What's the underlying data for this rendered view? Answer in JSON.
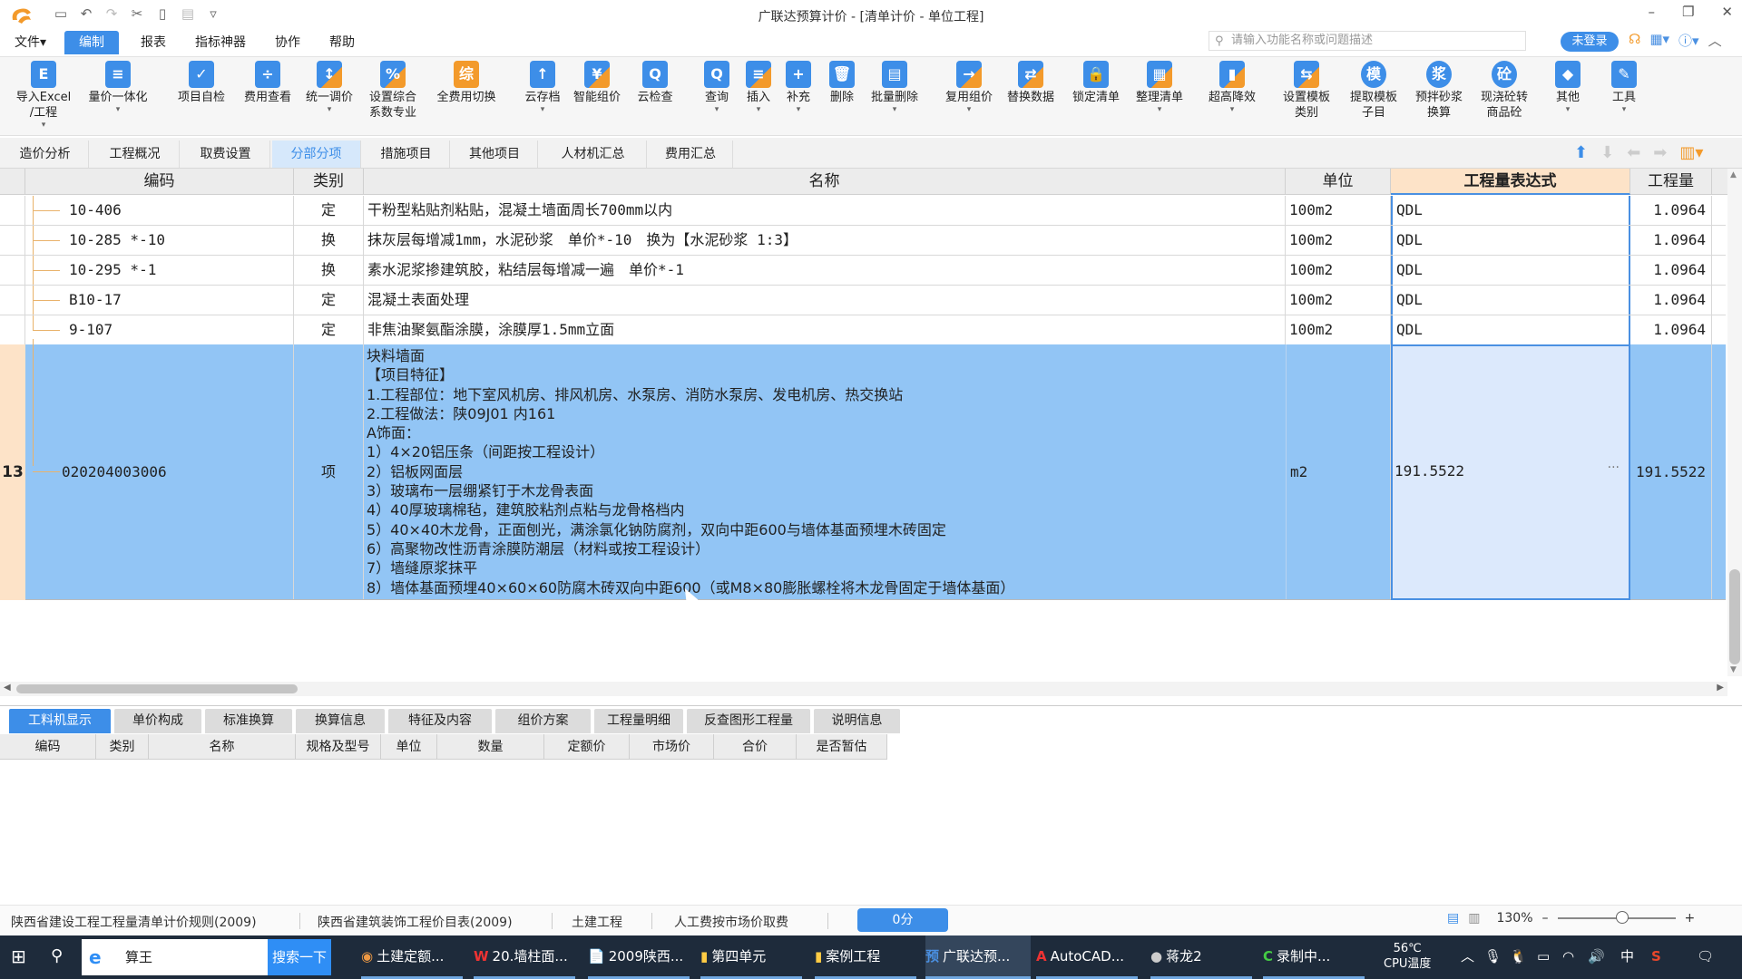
{
  "window": {
    "title": "广联达预算计价 - [清单计价 - 单位工程]",
    "controls": [
      "minimize",
      "restore",
      "close"
    ]
  },
  "quick_access": [
    "save-icon",
    "undo-icon",
    "redo-icon",
    "cut-icon",
    "copy-icon",
    "paste-icon",
    "customize-icon"
  ],
  "menu": {
    "items": [
      {
        "label": "文件▾",
        "active": false
      },
      {
        "label": "编制",
        "active": true
      },
      {
        "label": "报表",
        "active": false
      },
      {
        "label": "指标神器",
        "active": false
      },
      {
        "label": "协作",
        "active": false
      },
      {
        "label": "帮助",
        "active": false
      }
    ],
    "search_placeholder": "请输入功能名称或问题描述",
    "login_label": "未登录"
  },
  "ribbon": [
    {
      "label": "导入Excel",
      "label2": "/工程",
      "glyph": "E",
      "dd": true
    },
    {
      "label": "量价一体化",
      "label2": "",
      "glyph": "≡",
      "dd": true
    },
    {
      "label": "项目自检",
      "label2": "",
      "glyph": "✓",
      "dd": false
    },
    {
      "label": "费用查看",
      "label2": "",
      "glyph": "÷",
      "dd": false
    },
    {
      "label": "统一调价",
      "label2": "",
      "glyph": "↕",
      "dd": true
    },
    {
      "label": "设置综合",
      "label2": "系数专业",
      "glyph": "%",
      "dd": false
    },
    {
      "label": "全费用切换",
      "label2": "",
      "glyph": "综",
      "dd": false
    },
    {
      "label": "云存档",
      "label2": "",
      "glyph": "↑",
      "dd": true
    },
    {
      "label": "智能组价",
      "label2": "",
      "glyph": "¥",
      "dd": false
    },
    {
      "label": "云检查",
      "label2": "",
      "glyph": "Q",
      "dd": false
    },
    {
      "label": "查询",
      "label2": "",
      "glyph": "Q",
      "dd": true
    },
    {
      "label": "插入",
      "label2": "",
      "glyph": "≡",
      "dd": true
    },
    {
      "label": "补充",
      "label2": "",
      "glyph": "+",
      "dd": true
    },
    {
      "label": "删除",
      "label2": "",
      "glyph": "🗑",
      "dd": false
    },
    {
      "label": "批量删除",
      "label2": "",
      "glyph": "▤",
      "dd": true
    },
    {
      "label": "复用组价",
      "label2": "",
      "glyph": "→",
      "dd": true
    },
    {
      "label": "替换数据",
      "label2": "",
      "glyph": "⇄",
      "dd": false
    },
    {
      "label": "锁定清单",
      "label2": "",
      "glyph": "🔒",
      "dd": false
    },
    {
      "label": "整理清单",
      "label2": "",
      "glyph": "▦",
      "dd": true
    },
    {
      "label": "超高降效",
      "label2": "",
      "glyph": "▮",
      "dd": true
    },
    {
      "label": "设置模板",
      "label2": "类别",
      "glyph": "⇆",
      "dd": false
    },
    {
      "label": "提取模板",
      "label2": "子目",
      "glyph": "模",
      "dd": false
    },
    {
      "label": "预拌砂浆",
      "label2": "换算",
      "glyph": "浆",
      "dd": false
    },
    {
      "label": "现浇砼转",
      "label2": "商品砼",
      "glyph": "砼",
      "dd": false
    },
    {
      "label": "其他",
      "label2": "",
      "glyph": "◆",
      "dd": true
    },
    {
      "label": "工具",
      "label2": "",
      "glyph": "✎",
      "dd": true
    }
  ],
  "tabs": [
    {
      "label": "造价分析",
      "active": false
    },
    {
      "label": "工程概况",
      "active": false
    },
    {
      "label": "取费设置",
      "active": false
    },
    {
      "label": "分部分项",
      "active": true
    },
    {
      "label": "措施项目",
      "active": false
    },
    {
      "label": "其他项目",
      "active": false
    },
    {
      "label": "人材机汇总",
      "active": false
    },
    {
      "label": "费用汇总",
      "active": false
    }
  ],
  "grid": {
    "columns": [
      "编码",
      "类别",
      "名称",
      "单位",
      "工程量表达式",
      "工程量"
    ],
    "rows": [
      {
        "code": "10-406",
        "type": "定",
        "name": "干粉型粘贴剂粘贴，混凝土墙面周长700mm以内",
        "unit": "100m2",
        "expr": "QDL",
        "qty": "1.0964"
      },
      {
        "code": "10-285 *-10",
        "type": "换",
        "name": "抹灰层每增减1mm，水泥砂浆　单价*-10　换为【水泥砂浆 1:3】",
        "unit": "100m2",
        "expr": "QDL",
        "qty": "1.0964"
      },
      {
        "code": "10-295 *-1",
        "type": "换",
        "name": "素水泥浆掺建筑胶，粘结层每增减一遍　单价*-1",
        "unit": "100m2",
        "expr": "QDL",
        "qty": "1.0964"
      },
      {
        "code": "B10-17",
        "type": "定",
        "name": "混凝土表面处理",
        "unit": "100m2",
        "expr": "QDL",
        "qty": "1.0964"
      },
      {
        "code": "9-107",
        "type": "定",
        "name": "非焦油聚氨酯涂膜，涂膜厚1.5mm立面",
        "unit": "100m2",
        "expr": "QDL",
        "qty": "1.0964"
      }
    ],
    "selected": {
      "row_number": "13",
      "code": "020204003006",
      "type": "项",
      "unit": "m2",
      "expr": "191.5522",
      "qty": "191.5522",
      "description": [
        "块料墙面",
        "【项目特征】",
        "1.工程部位：地下室风机房、排风机房、水泵房、消防水泵房、发电机房、热交换站",
        "2.工程做法：陕09J01 内161",
        "A饰面：",
        "1）4×20铝压条（间距按工程设计）",
        "2）铝板网面层",
        "3）玻璃布一层绷紧钉于木龙骨表面",
        "4）40厚玻璃棉毡，建筑胶粘剂点粘与龙骨格档内",
        "5）40×40木龙骨，正面刨光，满涂氯化钠防腐剂，双向中距600与墙体基面预埋木砖固定",
        "6）高聚物改性沥青涂膜防潮层（材料或按工程设计）",
        "7）墙缝原浆抹平",
        "8）墙体基面预埋40×60×60防腐木砖双向中距600（或M8×80膨胀螺栓将木龙骨固定于墙体基面）"
      ]
    }
  },
  "bottom_tabs": [
    {
      "label": "工料机显示",
      "active": true
    },
    {
      "label": "单价构成",
      "active": false
    },
    {
      "label": "标准换算",
      "active": false
    },
    {
      "label": "换算信息",
      "active": false
    },
    {
      "label": "特征及内容",
      "active": false
    },
    {
      "label": "组价方案",
      "active": false
    },
    {
      "label": "工程量明细",
      "active": false
    },
    {
      "label": "反查图形工程量",
      "active": false
    },
    {
      "label": "说明信息",
      "active": false
    }
  ],
  "bottom_columns": [
    "编码",
    "类别",
    "名称",
    "规格及型号",
    "单位",
    "数量",
    "定额价",
    "市场价",
    "合价",
    "是否暂估"
  ],
  "status": {
    "items": [
      "陕西省建设工程工程量清单计价规则(2009)",
      "陕西省建筑装饰工程价目表(2009)",
      "土建工程",
      "人工费按市场价取费"
    ],
    "score": "0分",
    "zoom": "130%"
  },
  "taskbar": {
    "search_text": "算王",
    "search_button": "搜索一下",
    "apps": [
      "土建定额...",
      "20.墙柱面...",
      "2009陕西...",
      "第四单元",
      "案例工程",
      "广联达预...",
      "AutoCAD...",
      "蒋龙2",
      "录制中..."
    ],
    "cpu_temp": "56℃",
    "cpu_label": "CPU温度",
    "ime": "中"
  }
}
